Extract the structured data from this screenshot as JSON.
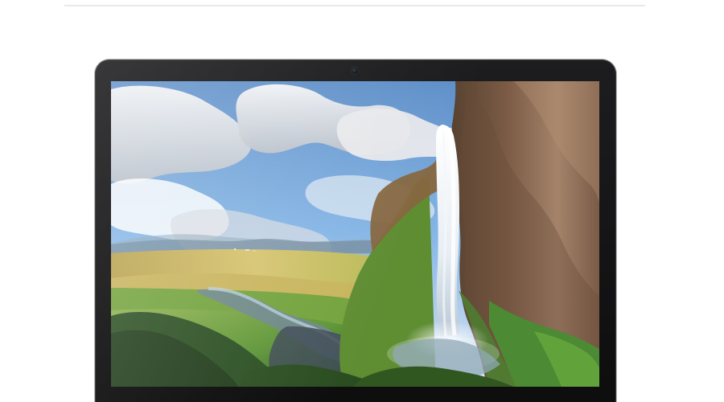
{
  "page": {
    "background": "#ffffff",
    "divider_color": "#e9e9e9"
  },
  "device": {
    "type": "laptop-display",
    "bezel_color": "#141416",
    "camera": "webcam-dot"
  },
  "wallpaper": {
    "subject": "waterfall-cliff-landscape",
    "colors": {
      "sky": "#6f9fd4",
      "clouds": "#e7e8ea",
      "cliff": "#7a5a43",
      "grass": "#5f9b36",
      "fields": "#c7b55a",
      "water": "#dfe6ee"
    }
  }
}
